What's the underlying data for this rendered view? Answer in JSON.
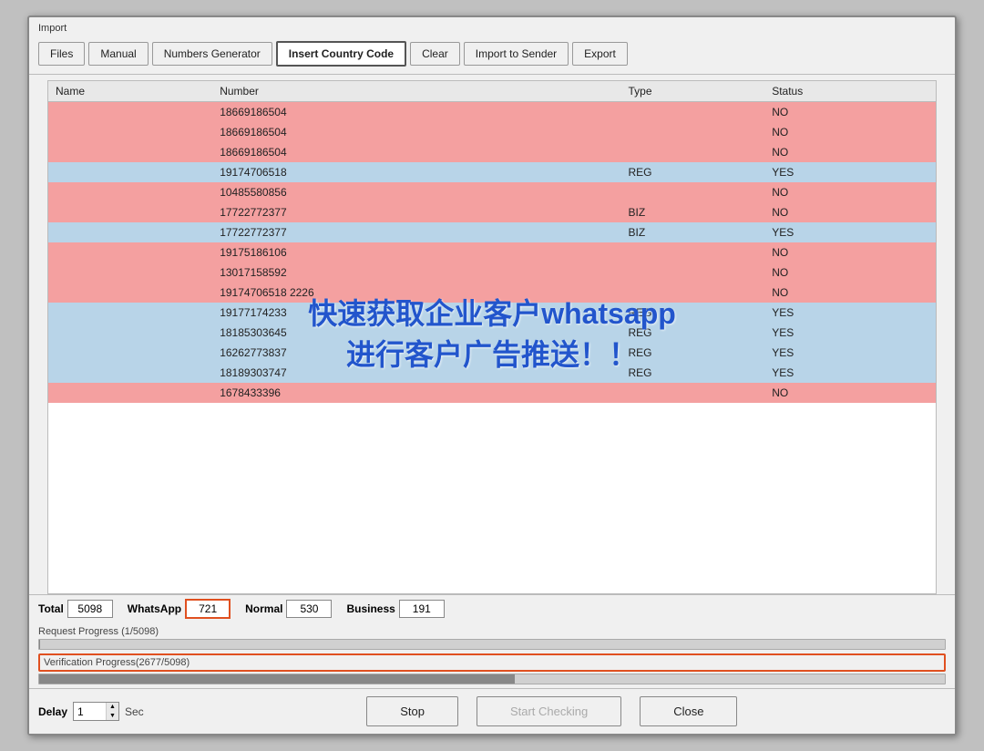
{
  "window": {
    "section_label": "Import",
    "toolbar": {
      "buttons": [
        {
          "id": "files",
          "label": "Files",
          "active": false
        },
        {
          "id": "manual",
          "label": "Manual",
          "active": false
        },
        {
          "id": "numbers-generator",
          "label": "Numbers Generator",
          "active": false
        },
        {
          "id": "insert-country-code",
          "label": "Insert Country Code",
          "active": true
        },
        {
          "id": "clear",
          "label": "Clear",
          "active": false
        },
        {
          "id": "import-to-sender",
          "label": "Import to Sender",
          "active": false
        },
        {
          "id": "export",
          "label": "Export",
          "active": false
        }
      ]
    },
    "table": {
      "columns": [
        "Name",
        "Number",
        "Type",
        "Status"
      ],
      "rows": [
        {
          "name": "",
          "number": "18669186504",
          "type": "",
          "status": "NO",
          "color": "red"
        },
        {
          "name": "",
          "number": "18669186504",
          "type": "",
          "status": "NO",
          "color": "red"
        },
        {
          "name": "",
          "number": "18669186504",
          "type": "",
          "status": "NO",
          "color": "red"
        },
        {
          "name": "",
          "number": "19174706518",
          "type": "REG",
          "status": "YES",
          "color": "blue"
        },
        {
          "name": "",
          "number": "10485580856",
          "type": "",
          "status": "NO",
          "color": "red"
        },
        {
          "name": "",
          "number": "17722772377",
          "type": "BIZ",
          "status": "NO",
          "color": "red"
        },
        {
          "name": "",
          "number": "17722772377",
          "type": "BIZ",
          "status": "YES",
          "color": "blue"
        },
        {
          "name": "",
          "number": "19175186106",
          "type": "",
          "status": "NO",
          "color": "red"
        },
        {
          "name": "",
          "number": "13017158592",
          "type": "",
          "status": "NO",
          "color": "red"
        },
        {
          "name": "",
          "number": "19174706518 2226",
          "type": "",
          "status": "NO",
          "color": "red"
        },
        {
          "name": "",
          "number": "19177174233",
          "type": "REG",
          "status": "YES",
          "color": "blue"
        },
        {
          "name": "",
          "number": "18185303645",
          "type": "REG",
          "status": "YES",
          "color": "blue"
        },
        {
          "name": "",
          "number": "16262773837",
          "type": "REG",
          "status": "YES",
          "color": "blue"
        },
        {
          "name": "",
          "number": "18189303747",
          "type": "REG",
          "status": "YES",
          "color": "blue"
        },
        {
          "name": "",
          "number": "1678433396",
          "type": "",
          "status": "NO",
          "color": "red"
        }
      ]
    },
    "watermark": {
      "line1": "快速获取企业客户whatsapp",
      "line2": "进行客户广告推送！！"
    },
    "stats": {
      "total_label": "Total",
      "total_value": "5098",
      "whatsapp_label": "WhatsApp",
      "whatsapp_value": "721",
      "normal_label": "Normal",
      "normal_value": "530",
      "business_label": "Business",
      "business_value": "191"
    },
    "progress": {
      "request_label": "Request Progress (1/5098)",
      "request_percent": 0.02,
      "verification_label": "Verification Progress(2677/5098)",
      "verification_percent": 52.5
    },
    "delay": {
      "label": "Delay",
      "value": "1",
      "sec_label": "Sec"
    },
    "buttons": {
      "stop": "Stop",
      "start_checking": "Start Checking",
      "close": "Close"
    }
  }
}
